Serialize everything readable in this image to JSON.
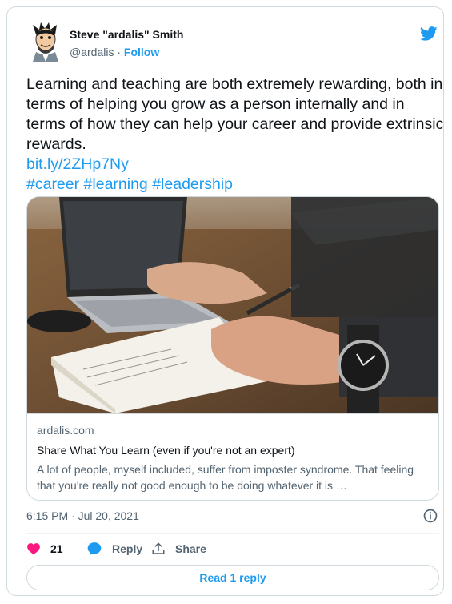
{
  "author": {
    "name": "Steve \"ardalis\" Smith",
    "handle": "@ardalis",
    "separator": "·",
    "follow_label": "Follow"
  },
  "tweet": {
    "text": "Learning and teaching are both extremely rewarding, both in terms of helping you grow as a person internally and in terms of how they can help your career and provide extrinsic rewards.",
    "link": "bit.ly/2ZHp7Ny",
    "hashtags": [
      "#career",
      "#learning",
      "#leadership"
    ]
  },
  "link_card": {
    "domain": "ardalis.com",
    "title": "Share What You Learn (even if you're not an expert)",
    "description": "A lot of people, myself included, suffer from imposter syndrome. That feeling that you're really not good enough to be doing whatever it is …"
  },
  "timestamp": "6:15 PM · Jul 20, 2021",
  "actions": {
    "like_count": "21",
    "reply_label": "Reply",
    "share_label": "Share"
  },
  "read_replies_label": "Read 1 reply",
  "icons": {
    "brand": "twitter-bird-icon",
    "like": "heart-icon",
    "reply": "speech-bubble-icon",
    "share": "share-upload-icon",
    "info": "info-icon"
  },
  "colors": {
    "accent": "#1d9bf0",
    "like": "#f91880",
    "text": "#0f1419",
    "muted": "#536471",
    "border": "#cfd9de"
  }
}
